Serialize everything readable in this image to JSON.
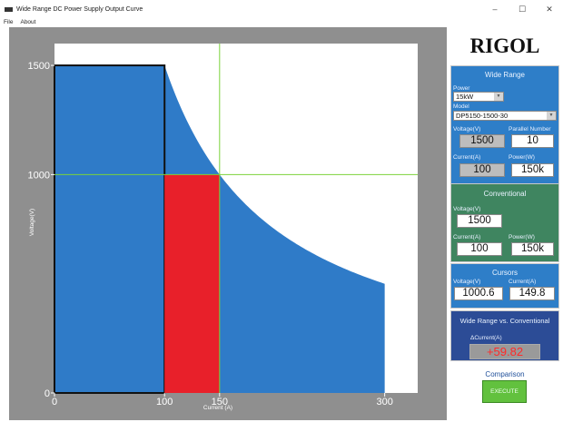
{
  "window": {
    "title": "Wide Range DC Power Supply Output Curve",
    "minimize_glyph": "–",
    "maximize_glyph": "☐",
    "close_glyph": "✕"
  },
  "menu": {
    "items": [
      "File",
      "About"
    ]
  },
  "plot": {
    "y_axis_label": "Voltage(V)",
    "x_axis_label": "Current (A)",
    "y_ticks": [
      "0",
      "1000",
      "1500"
    ],
    "x_ticks": [
      "0",
      "100",
      "150",
      "300"
    ],
    "colors": {
      "wide_area": "#2f7bc8",
      "conventional_area": "#e8202a",
      "cursor": "#7bd23a",
      "frame": "#8f8f8f"
    },
    "chart_data": {
      "type": "area",
      "xlim": [
        0,
        330
      ],
      "ylim": [
        0,
        1600
      ],
      "wide_range_curve": {
        "power_w": 150000,
        "max_voltage": 1500,
        "max_current": 300
      },
      "conventional_rect": {
        "voltage": 1500,
        "current": 100
      },
      "highlight_rect": {
        "current_from": 100,
        "current_to": 150,
        "voltage": 1000
      },
      "cursor": {
        "voltage": 1000,
        "current": 150
      }
    }
  },
  "panel": {
    "logo": "RIGOL",
    "wide_range": {
      "title": "Wide Range",
      "power_label": "Power",
      "power_value": "15kW",
      "model_label": "Model",
      "model_value": "DP5150-1500-30",
      "voltage_label": "Voltage(V)",
      "voltage_value": "1500",
      "parallel_label": "Parallel Number",
      "parallel_value": "10",
      "current_label": "Current(A)",
      "current_value": "100",
      "power_w_label": "Power(W)",
      "power_w_value": "150k"
    },
    "conventional": {
      "title": "Conventional",
      "voltage_label": "Voltage(V)",
      "voltage_value": "1500",
      "current_label": "Current(A)",
      "current_value": "100",
      "power_label": "Power(W)",
      "power_value": "150k"
    },
    "cursors": {
      "title": "Cursors",
      "voltage_label": "Voltage(V)",
      "voltage_value": "1000.6",
      "current_label": "Current(A)",
      "current_value": "149.8"
    },
    "comparison_box": {
      "title": "Wide Range vs. Conventional",
      "delta_label": "ΔCurrent(A)",
      "delta_value": "+59.82"
    },
    "comparison": {
      "title": "Comparison",
      "execute_label": "EXECUTE"
    }
  }
}
